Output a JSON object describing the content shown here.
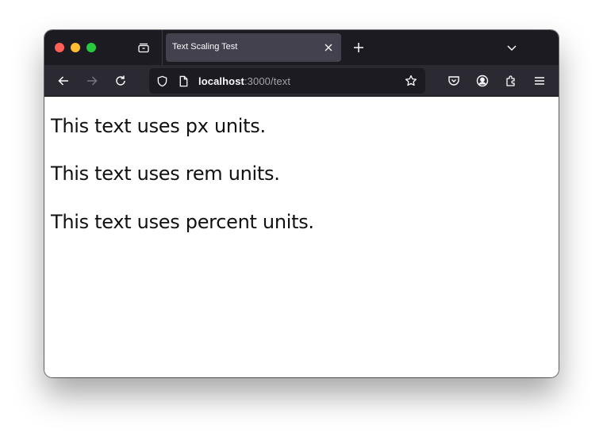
{
  "browser": {
    "tab": {
      "title": "Text Scaling Test"
    },
    "urlbar": {
      "host": "localhost",
      "path": ":3000/text"
    }
  },
  "page": {
    "lines": [
      "This text uses px units.",
      "This text uses rem units.",
      "This text uses percent units."
    ]
  }
}
